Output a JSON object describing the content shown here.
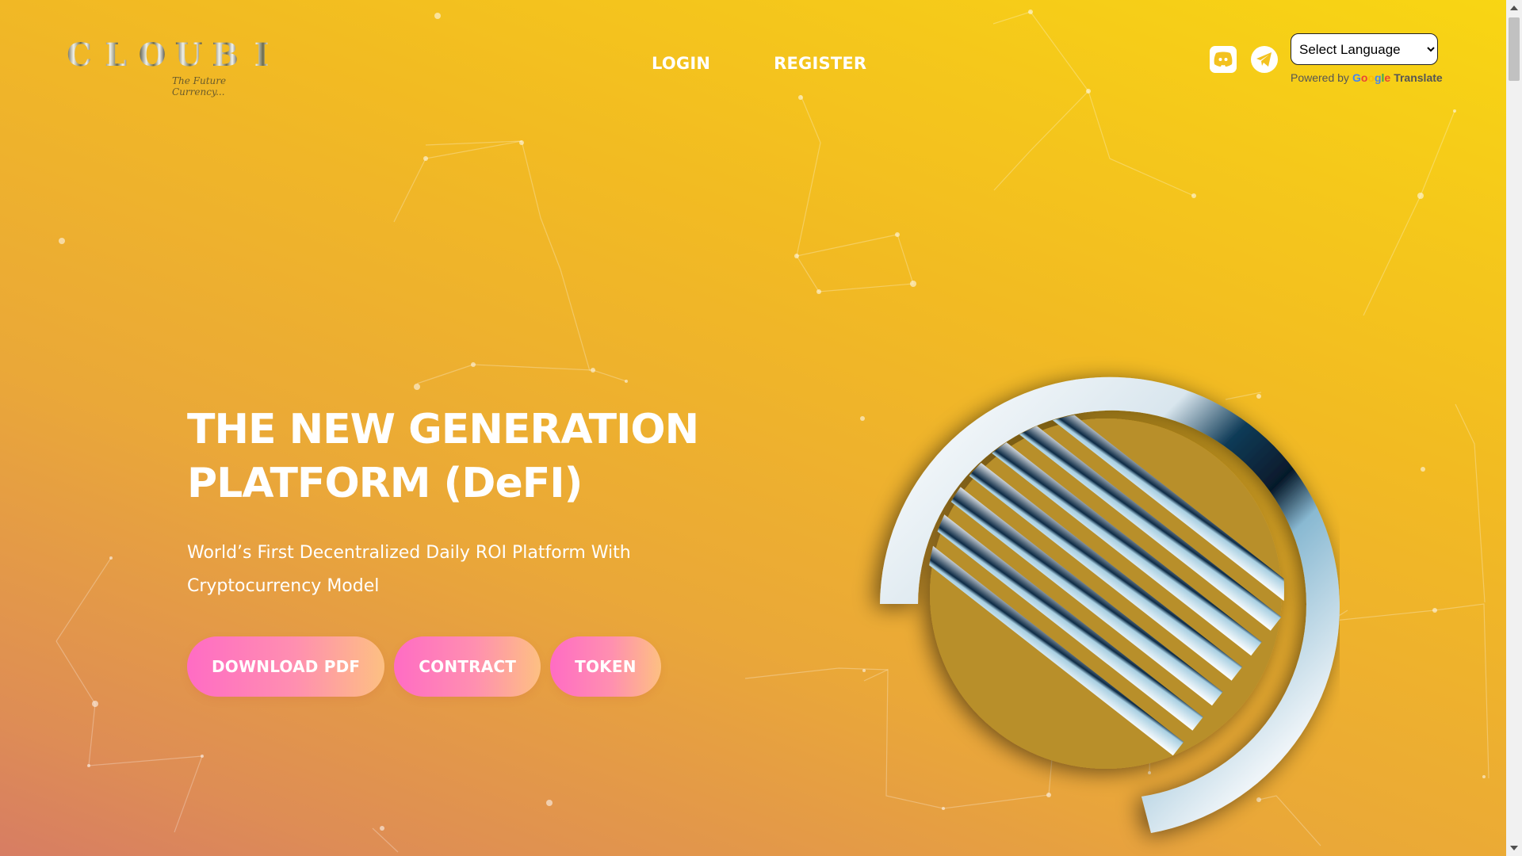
{
  "header": {
    "logo_letters": [
      "C",
      "L",
      "O",
      "U",
      "B",
      "I"
    ],
    "logo_tagline": "The Future Currency...",
    "nav": {
      "login": "LOGIN",
      "register": "REGISTER"
    },
    "social": [
      {
        "name": "discord",
        "icon": "discord-icon"
      },
      {
        "name": "telegram",
        "icon": "telegram-icon"
      }
    ],
    "translate": {
      "selected_language": "Select Language",
      "powered_by": "Powered by",
      "google": "Google",
      "translate_label": "Translate"
    }
  },
  "hero": {
    "title_line1": "THE NEW GENERATION",
    "title_line2": "PLATFORM (DeFI)",
    "subtitle": "World’s First Decentralized Daily ROI Platform With Cryptocurrency Model",
    "buttons": {
      "download": "DOWNLOAD PDF",
      "contract": "CONTRACT",
      "token": "TOKEN"
    }
  },
  "colors": {
    "background_top": "#f8d613",
    "background_bottom": "#d77d63",
    "button_gradient_start": "#ff6cc4",
    "button_gradient_end": "#fdc082",
    "text": "#ffffff"
  }
}
